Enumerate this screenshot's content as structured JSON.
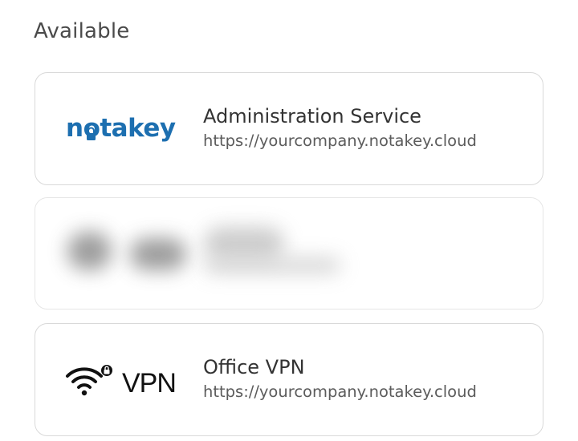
{
  "section": {
    "title": "Available"
  },
  "services": [
    {
      "logo_text": "notakey",
      "logo_icon": "padlock-icon",
      "title": "Administration Service",
      "url": "https://yourcompany.notakey.cloud",
      "brand_color": "#1d6fb0"
    },
    {
      "blurred": true
    },
    {
      "logo_text": "VPN",
      "logo_icon": "wifi-lock-icon",
      "title": "Office VPN",
      "url": "https://yourcompany.notakey.cloud",
      "brand_color": "#111111"
    }
  ]
}
